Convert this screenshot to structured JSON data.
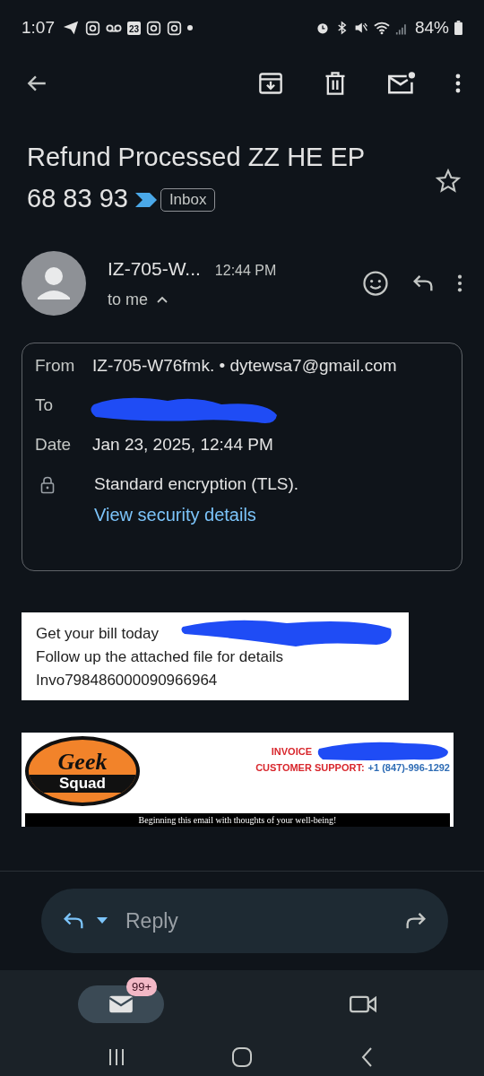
{
  "status_bar": {
    "time": "1:07",
    "calendar_day": "23",
    "battery": "84%"
  },
  "subject": {
    "lines": [
      "Refund Processed ZZ HE EP",
      "68 83 93"
    ],
    "important": true,
    "label": "Inbox",
    "starred": false
  },
  "sender": {
    "name": "IZ-705-W...",
    "time": "12:44 PM",
    "recipient": "to me",
    "expanded": true
  },
  "details": {
    "rows": [
      {
        "label": "From",
        "value": "IZ-705-W76fmk. • dytewsa7@gmail.com"
      },
      {
        "label": "To",
        "redacted": true
      },
      {
        "label": "Date",
        "value": "Jan 23, 2025, 12:44 PM"
      }
    ],
    "encryption": "Standard encryption (TLS).",
    "link": "View security details"
  },
  "body": {
    "notice_lines": [
      {
        "text": "Get your bill today",
        "redacted": true
      },
      {
        "text": "Follow up the attached file for details"
      },
      {
        "text": "Invo798486000090966964"
      }
    ],
    "invoice_header": {
      "logo_top": "Geek",
      "logo_bottom": "Squad",
      "invoice": "INVOICE",
      "support": "CUSTOMER SUPPORT:",
      "phone": "+1 (847)-996-1292",
      "banner": "Beginning this email with thoughts of your well-being!"
    }
  },
  "reply_bar": {
    "placeholder": "Reply"
  },
  "bottom_nav": [
    {
      "kind": "mail",
      "badge": "99+",
      "selected": true
    },
    {
      "kind": "meet",
      "selected": false
    }
  ]
}
